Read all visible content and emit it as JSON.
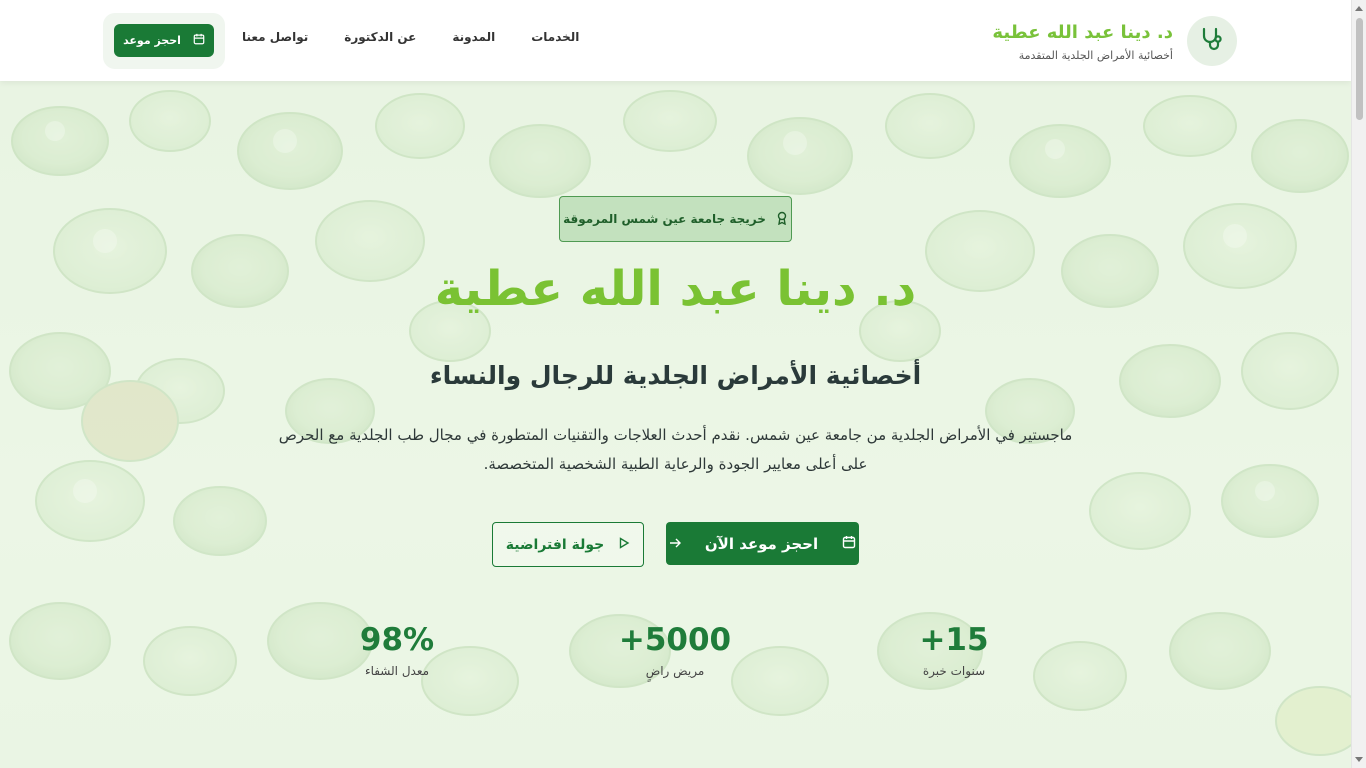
{
  "header": {
    "brand_name": "د. دينا عبد الله عطية",
    "brand_tagline": "أخصائية الأمراض الجلدية المتقدمة",
    "brand_icon": "stethoscope-icon",
    "nav": [
      {
        "label": "الخدمات"
      },
      {
        "label": "المدونة"
      },
      {
        "label": "عن الدكتورة"
      },
      {
        "label": "تواصل معنا"
      }
    ],
    "cta_label": "احجز موعد",
    "cta_icon": "calendar-icon"
  },
  "hero": {
    "badge_icon": "award-icon",
    "badge_text": "خريجة جامعة عين شمس المرموقة",
    "title": "د. دينا عبد الله عطية",
    "subtitle": "أخصائية الأمراض الجلدية للرجال والنساء",
    "description": "ماجستير في الأمراض الجلدية من جامعة عين شمس. نقدم أحدث العلاجات والتقنيات المتطورة في مجال طب الجلدية مع الحرص على أعلى معايير الجودة والرعاية الطبية الشخصية المتخصصة.",
    "primary_button": {
      "label": "احجز موعد الآن",
      "icon": "calendar-icon",
      "trailing_icon": "arrow-right-icon"
    },
    "secondary_button": {
      "label": "جولة افتراضية",
      "icon": "play-icon"
    }
  },
  "stats": [
    {
      "value": "+15",
      "label": "سنوات خبرة"
    },
    {
      "value": "+5000",
      "label": "مريض راضٍ"
    },
    {
      "value": "98%",
      "label": "معدل الشفاء"
    }
  ],
  "colors": {
    "brand_green": "#79c23a",
    "primary_dark_green": "#1a7a36",
    "stat_green": "#1f7c3a"
  }
}
